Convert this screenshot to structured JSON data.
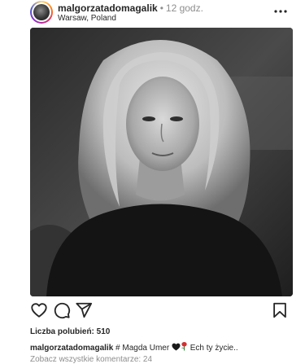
{
  "post": {
    "username": "malgorzatadomagalik",
    "separator": "•",
    "time": "12 godz.",
    "location": "Warsaw, Poland",
    "icons": {
      "more": "more-options-icon",
      "like": "heart-icon",
      "comment": "comment-icon",
      "share": "share-icon",
      "save": "bookmark-icon",
      "emoji_black_heart": "black-heart-emoji",
      "emoji_rose": "rose-emoji"
    },
    "likes_label": "Liczba polubień:",
    "likes_count": "510",
    "caption": {
      "username": "malgorzatadomagalik",
      "text_before": "# Magda Umer",
      "text_after": "Ech ty życie.."
    },
    "view_comments": "Zobacz wszystkie komentarze: 24"
  }
}
